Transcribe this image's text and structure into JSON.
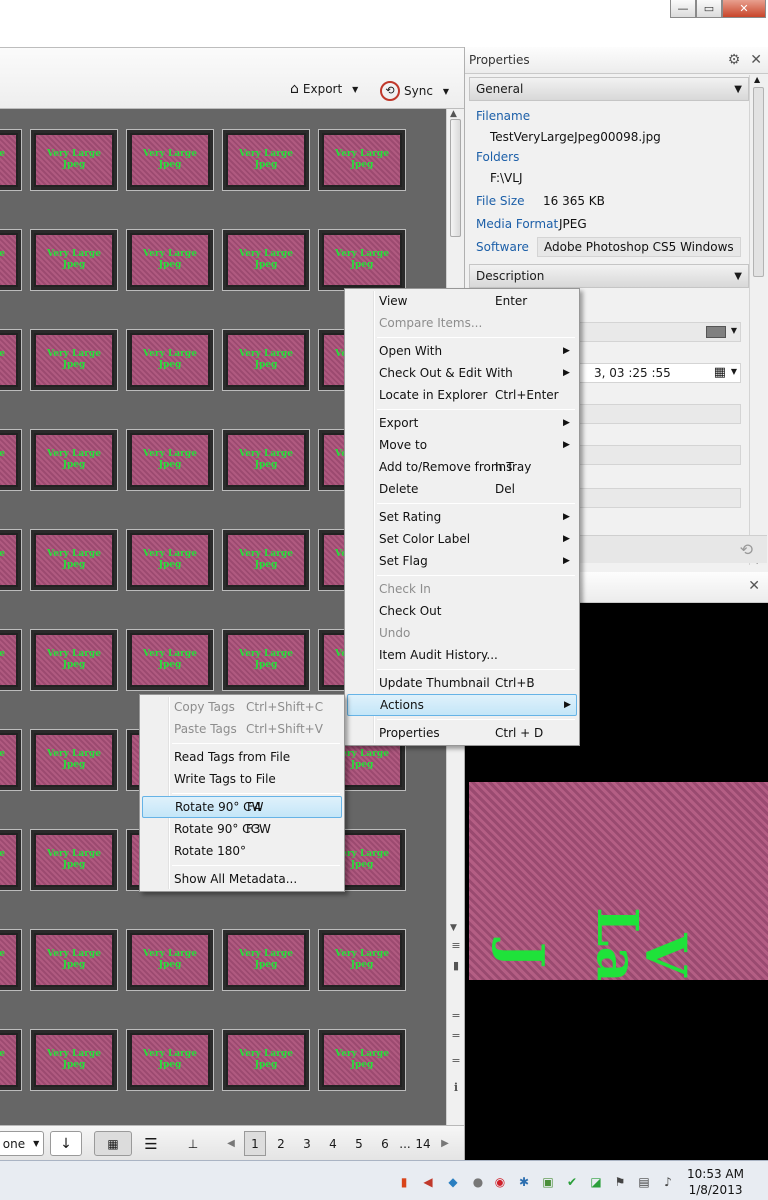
{
  "window": {
    "minimize_glyph": "—",
    "maximize_glyph": "▭",
    "close_glyph": "✕"
  },
  "toolbar": {
    "export_label": "Export",
    "sync_label": "Sync"
  },
  "thumbnail_text": "Very Large Jpeg",
  "bottom_bar": {
    "view_select": "one",
    "pages": [
      "1",
      "2",
      "3",
      "4",
      "5",
      "6",
      "...",
      "14"
    ],
    "active_page": "1"
  },
  "properties": {
    "title": "Properties",
    "general_label": "General",
    "description_label": "Description",
    "filename_label": "Filename",
    "filename_value": "TestVeryLargeJpeg00098.jpg",
    "folders_label": "Folders",
    "folders_value": "F:\\VLJ",
    "filesize_label": "File Size",
    "filesize_value": "16 365 KB",
    "mediaformat_label": "Media Format",
    "mediaformat_value": "JPEG",
    "software_label": "Software",
    "software_value": "Adobe Photoshop CS5 Windows",
    "date_fragment": "3, 03 :25 :55"
  },
  "context_menu": {
    "items": [
      {
        "label": "View",
        "shortcut": "Enter"
      },
      {
        "label": "Compare Items...",
        "shortcut": "",
        "disabled": true
      },
      {
        "label": "Open With",
        "submenu": true
      },
      {
        "label": "Check Out & Edit With",
        "submenu": true
      },
      {
        "label": "Locate in Explorer",
        "shortcut": "Ctrl+Enter"
      },
      {
        "label": "Export",
        "submenu": true
      },
      {
        "label": "Move to",
        "submenu": true
      },
      {
        "label": "Add to/Remove from Tray",
        "shortcut": "Ins"
      },
      {
        "label": "Delete",
        "shortcut": "Del"
      },
      {
        "label": "Set Rating",
        "submenu": true
      },
      {
        "label": "Set Color Label",
        "submenu": true
      },
      {
        "label": "Set Flag",
        "submenu": true
      },
      {
        "label": "Check In",
        "disabled": true
      },
      {
        "label": "Check Out"
      },
      {
        "label": "Undo",
        "disabled": true
      },
      {
        "label": "Item Audit History..."
      },
      {
        "label": "Update Thumbnail",
        "shortcut": "Ctrl+B"
      },
      {
        "label": "Actions",
        "submenu": true,
        "highlighted": true
      },
      {
        "label": "Properties",
        "shortcut": "Ctrl + D"
      }
    ]
  },
  "actions_submenu": {
    "items": [
      {
        "label": "Copy Tags",
        "shortcut": "Ctrl+Shift+C",
        "disabled": true
      },
      {
        "label": "Paste Tags",
        "shortcut": "Ctrl+Shift+V",
        "disabled": true
      },
      {
        "label": "Read Tags from File"
      },
      {
        "label": "Write Tags to File"
      },
      {
        "label": "Rotate 90° CW",
        "shortcut": "F4",
        "highlighted": true
      },
      {
        "label": "Rotate 90° CCW",
        "shortcut": "F3"
      },
      {
        "label": "Rotate 180°"
      },
      {
        "label": "Show All Metadata..."
      }
    ]
  },
  "taskbar": {
    "time": "10:53 AM",
    "date": "1/8/2013"
  },
  "colors": {
    "menu_highlight": "#c4e6f8",
    "label_blue": "#1c5fa8",
    "thumb_text_green": "#25e23a",
    "thumb_pink": "#b05a80"
  }
}
